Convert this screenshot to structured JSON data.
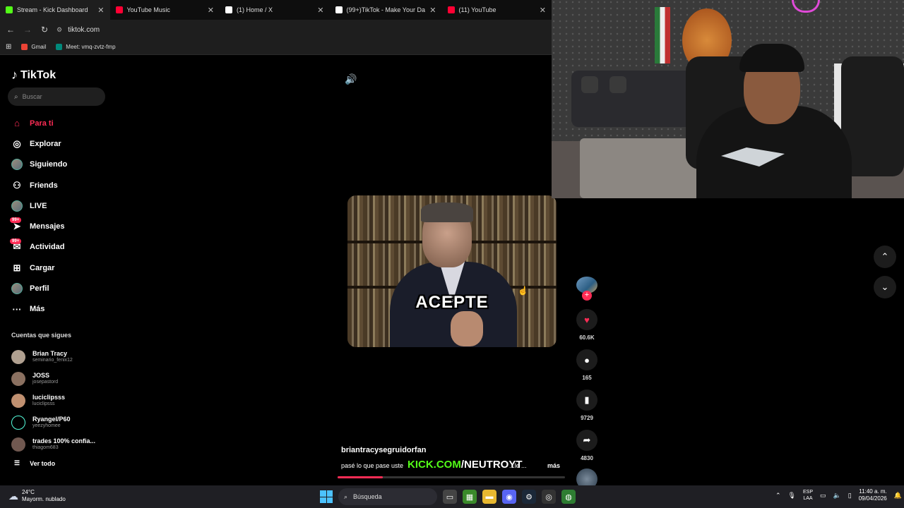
{
  "browser": {
    "tabs": [
      {
        "title": "Stream - Kick Dashboard",
        "color": "#53fc18",
        "active": true
      },
      {
        "title": "YouTube Music",
        "color": "#ff0033",
        "active": false
      },
      {
        "title": "(1) Home / X",
        "color": "#ffffff",
        "active": false
      },
      {
        "title": "(99+)TikTok - Make Your Da...",
        "color": "#ffffff",
        "active": false
      },
      {
        "title": "(11) YouTube",
        "color": "#ff0033",
        "active": false
      }
    ],
    "url": "tiktok.com",
    "bookmarks": [
      {
        "label": "Gmail",
        "color": "#ea4335"
      },
      {
        "label": "Meet: vmq-zvtz-fmp",
        "color": "#00897b"
      }
    ]
  },
  "tiktok": {
    "brand": "TikTok",
    "search_placeholder": "Buscar",
    "menu": [
      {
        "label": "Para ti",
        "icon": "home-icon",
        "glyph": "⌂",
        "active": true
      },
      {
        "label": "Explorar",
        "icon": "compass-icon",
        "glyph": "◎",
        "active": false
      },
      {
        "label": "Siguiendo",
        "icon": "avatar-icon",
        "glyph": "",
        "active": false
      },
      {
        "label": "Friends",
        "icon": "friends-icon",
        "glyph": "⚇",
        "active": false
      },
      {
        "label": "LIVE",
        "icon": "live-avatar-icon",
        "glyph": "",
        "active": false
      },
      {
        "label": "Mensajes",
        "icon": "messages-icon",
        "glyph": "➤",
        "badge": "99+",
        "active": false
      },
      {
        "label": "Actividad",
        "icon": "activity-icon",
        "glyph": "✉",
        "badge": "99+",
        "active": false
      },
      {
        "label": "Cargar",
        "icon": "upload-icon",
        "glyph": "⊞",
        "active": false
      },
      {
        "label": "Perfil",
        "icon": "profile-avatar-icon",
        "glyph": "",
        "active": false
      },
      {
        "label": "Más",
        "icon": "more-icon",
        "glyph": "···",
        "active": false
      }
    ],
    "following_heading": "Cuentas que sigues",
    "accounts": [
      {
        "name": "Brian Tracy",
        "handle": "seminario_fenix12",
        "color": "#b0a090"
      },
      {
        "name": "JOSS",
        "handle": "josepastord",
        "color": "#8a7060"
      },
      {
        "name": "luciclipsss",
        "handle": "luciclipsss",
        "color": "#c09070"
      },
      {
        "name": "Ryangel/P60",
        "handle": "yeezyhomee",
        "color": "#000000"
      },
      {
        "name": "trades 100% confia...",
        "handle": "thiagom683",
        "color": "#705850"
      }
    ],
    "see_all": "Ver todo"
  },
  "video": {
    "overlay_text": "ACEPTE",
    "author": "briantracysegruidorfan",
    "description": "pasé lo que pase uste",
    "description_tail": "...le ...",
    "more_label": "más",
    "kick_green": "KICK.COM",
    "kick_white": "/NEUTROYT",
    "progress": 0.2,
    "likes": "60.6K",
    "comments": "165",
    "saves": "9729",
    "shares": "4830"
  },
  "taskbar": {
    "temp": "24°C",
    "weather": "Mayorm. nublado",
    "search": "Búsqueda",
    "lang1": "ESP",
    "lang2": "LAA",
    "time": "11:40 a. m.",
    "date": "09/04/2026"
  }
}
